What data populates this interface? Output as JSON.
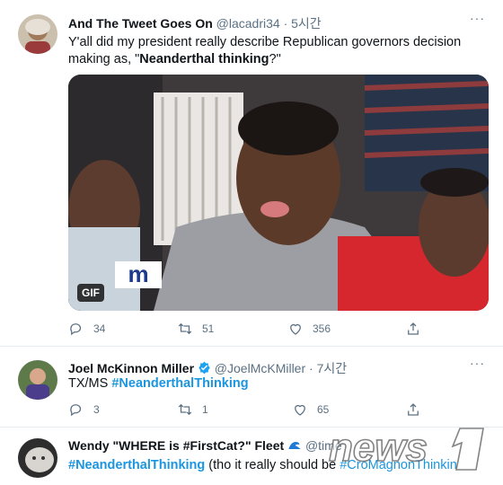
{
  "tweets": [
    {
      "name": "And The Tweet Goes On",
      "handle": "@lacadri34 · 5시간",
      "text_before": "Y'all did my president really describe  Republican governors decision making as, \"",
      "text_bold": "Neanderthal thinking",
      "text_after": "?\"",
      "media_badge": "GIF",
      "media_logo": "m",
      "replies": "34",
      "retweets": "51",
      "likes": "356"
    },
    {
      "name": "Joel McKinnon Miller",
      "handle": "@JoelMcKMiller · 7시간",
      "text_prefix": "TX/MS ",
      "hashtag": "#NeanderthalThinking",
      "replies": "3",
      "retweets": "1",
      "likes": "65"
    },
    {
      "name": "Wendy \"WHERE is #FirstCat?\" Fleet",
      "handle": "@time",
      "hashtag": "#NeanderthalThinking",
      "text_after": " (tho it really should be ",
      "hashtag2": "#CroMagnonThinkin"
    }
  ],
  "more_label": "···",
  "watermark": "news1",
  "colors": {
    "link": "#1b95e0",
    "verified": "#1da1f2",
    "muted": "#5b7083",
    "text": "#0f1419"
  },
  "icons": [
    "reply-icon",
    "retweet-icon",
    "like-icon",
    "share-icon",
    "verified-icon",
    "wave-icon",
    "more-icon"
  ]
}
